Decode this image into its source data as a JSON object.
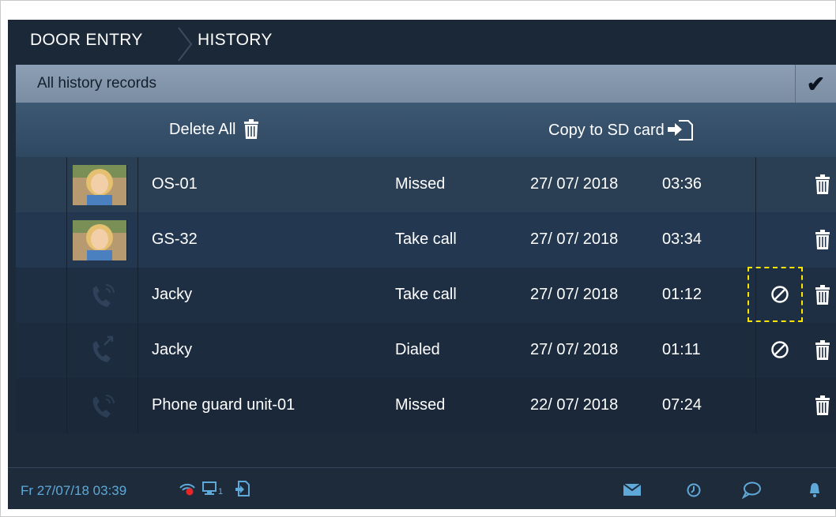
{
  "breadcrumb": {
    "root": "DOOR ENTRY",
    "current": "HISTORY"
  },
  "filter": {
    "label": "All history records",
    "confirm_icon": "check-icon"
  },
  "actions": {
    "delete_all": "Delete All",
    "copy_sd": "Copy to SD card"
  },
  "records": [
    {
      "name": "OS-01",
      "status": "Missed",
      "date": "27/ 07/ 2018",
      "time": "03:36",
      "icon": "photo-thumbnail",
      "block": false
    },
    {
      "name": "GS-32",
      "status": "Take call",
      "date": "27/ 07/ 2018",
      "time": "03:34",
      "icon": "photo-thumbnail",
      "block": false
    },
    {
      "name": "Jacky",
      "status": "Take call",
      "date": "27/ 07/ 2018",
      "time": "01:12",
      "icon": "incoming-call-icon",
      "block": true
    },
    {
      "name": "Jacky",
      "status": "Dialed",
      "date": "27/ 07/ 2018",
      "time": "01:11",
      "icon": "outgoing-call-icon",
      "block": true
    },
    {
      "name": "Phone guard unit-01",
      "status": "Missed",
      "date": "22/ 07/ 2018",
      "time": "07:24",
      "icon": "incoming-call-icon",
      "block": false
    }
  ],
  "statusbar": {
    "datetime": "Fr 27/07/18  03:39",
    "monitor_sub": "1"
  },
  "colors": {
    "accent": "#5fa9d8",
    "highlight": "#ffe600",
    "alarm": "#e8262a"
  }
}
